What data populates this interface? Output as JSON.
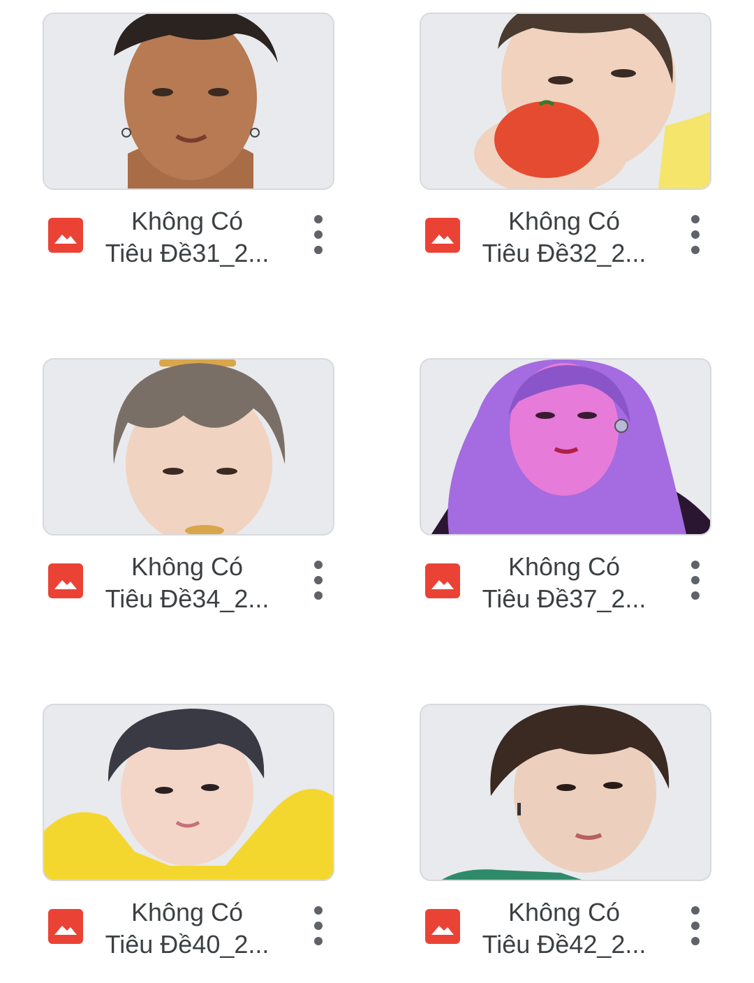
{
  "files": [
    {
      "line1": "Không Có",
      "line2": "Tiêu Đề31_2...",
      "thumb_tone": "#b77a52",
      "hair": "#2a2320",
      "bg": "#e8eaed"
    },
    {
      "line1": "Không Có",
      "line2": "Tiêu Đề32_2...",
      "thumb_tone": "#f0d2bf",
      "hair": "#4a3a30",
      "bg": "#e8eaed"
    },
    {
      "line1": "Không Có",
      "line2": "Tiêu Đề34_2...",
      "thumb_tone": "#f1d3c2",
      "hair": "#7a6f66",
      "bg": "#e8eaed"
    },
    {
      "line1": "Không Có",
      "line2": "Tiêu Đề37_2...",
      "thumb_tone": "#e77bd9",
      "hair": "#a56be0",
      "bg": "#e8eaed"
    },
    {
      "line1": "Không Có",
      "line2": "Tiêu Đề40_2...",
      "thumb_tone": "#f3d6c8",
      "hair": "#3a3a45",
      "bg": "#e8eaed"
    },
    {
      "line1": "Không Có",
      "line2": "Tiêu Đề42_2...",
      "thumb_tone": "#ecd0bd",
      "hair": "#3b2a22",
      "bg": "#e8eaed"
    }
  ],
  "colors": {
    "image_file_icon": "#ea4335",
    "title_text": "#3c4043",
    "more_dots": "#5f6368",
    "thumb_border": "#d7d9dc"
  },
  "icons": {
    "file_type": "image-file-icon",
    "menu": "more-vert-icon"
  }
}
